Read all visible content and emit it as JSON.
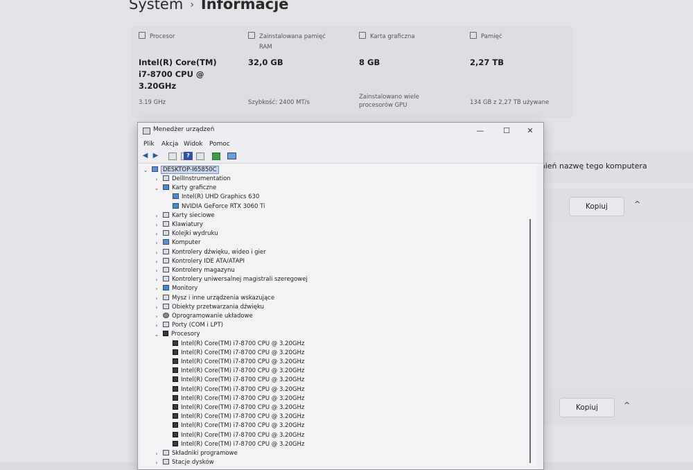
{
  "breadcrumb": {
    "parent": "System",
    "separator": "›",
    "current": "Informacje"
  },
  "specs": [
    {
      "icon": "cpu-icon",
      "label": "Procesor",
      "value_lines": [
        "Intel(R) Core(TM)",
        "i7-8700 CPU @",
        "3.20GHz"
      ],
      "sub_lines": [
        "3.19 GHz"
      ]
    },
    {
      "icon": "ram-icon",
      "label_lines": [
        "Zainstalowana pamięć",
        "RAM"
      ],
      "value_lines": [
        "32,0 GB"
      ],
      "sub_lines": [
        "Szybkość: 2400 MT/s"
      ]
    },
    {
      "icon": "gpu-icon",
      "label": "Karta graficzna",
      "value_lines": [
        "8 GB"
      ],
      "sub_lines": [
        "Zainstalowano wiele",
        "procesorów GPU"
      ]
    },
    {
      "icon": "storage-icon",
      "label": "Pamięć",
      "value_lines": [
        "2,27 TB"
      ],
      "sub_lines": [
        "134 GB z 2,27 TB używane"
      ]
    }
  ],
  "rename": {
    "label": "mień nazwę tego komputera"
  },
  "cards": [
    {
      "copy_label": "Kopiuj",
      "chevron": "^"
    },
    {
      "copy_label": "Kopiuj",
      "chevron": "^"
    }
  ],
  "device_manager": {
    "title": "Menedżer urządzeń",
    "controls": {
      "minimize": "—",
      "maximize": "☐",
      "close": "✕"
    },
    "menu": [
      "Plik",
      "Akcja",
      "Widok",
      "Pomoc"
    ],
    "toolbar": [
      "back-arrow-icon",
      "forward-arrow-icon",
      "properties-icon",
      "properties-icon",
      "help-icon",
      "properties-icon",
      "scan-icon",
      "monitor-icon"
    ],
    "root": "DESKTOP-I65850C",
    "tree": [
      {
        "label": "DellInstrumentation",
        "level": 1,
        "expander": "›",
        "icon": "device-icon"
      },
      {
        "label": "Karty graficzne",
        "level": 1,
        "expander": "⌄",
        "icon": "monitor-icon"
      },
      {
        "label": "Intel(R) UHD Graphics 630",
        "level": 2,
        "expander": "",
        "icon": "monitor-icon"
      },
      {
        "label": "NVIDIA GeForce RTX 3060 Ti",
        "level": 2,
        "expander": "",
        "icon": "monitor-icon"
      },
      {
        "label": "Karty sieciowe",
        "level": 1,
        "expander": "›",
        "icon": "network-icon"
      },
      {
        "label": "Klawiatury",
        "level": 1,
        "expander": "›",
        "icon": "keyboard-icon"
      },
      {
        "label": "Kolejki wydruku",
        "level": 1,
        "expander": "›",
        "icon": "printer-icon"
      },
      {
        "label": "Komputer",
        "level": 1,
        "expander": "›",
        "icon": "computer-icon"
      },
      {
        "label": "Kontrolery dźwięku, wideo i gier",
        "level": 1,
        "expander": "›",
        "icon": "speaker-icon"
      },
      {
        "label": "Kontrolery IDE ATA/ATAPI",
        "level": 1,
        "expander": "›",
        "icon": "controller-icon"
      },
      {
        "label": "Kontrolery magazynu",
        "level": 1,
        "expander": "›",
        "icon": "storage-icon"
      },
      {
        "label": "Kontrolery uniwersalnej magistrali szeregowej",
        "level": 1,
        "expander": "›",
        "icon": "usb-icon"
      },
      {
        "label": "Monitory",
        "level": 1,
        "expander": "›",
        "icon": "monitor-icon"
      },
      {
        "label": "Mysz i inne urządzenia wskazujące",
        "level": 1,
        "expander": "›",
        "icon": "mouse-icon"
      },
      {
        "label": "Obiekty przetwarzania dźwięku",
        "level": 1,
        "expander": "›",
        "icon": "speaker-icon"
      },
      {
        "label": "Oprogramowanie układowe",
        "level": 1,
        "expander": "›",
        "icon": "firmware-icon"
      },
      {
        "label": "Porty (COM i LPT)",
        "level": 1,
        "expander": "›",
        "icon": "port-icon"
      },
      {
        "label": "Procesory",
        "level": 1,
        "expander": "⌄",
        "icon": "cpu-icon"
      },
      {
        "label": "Intel(R) Core(TM) i7-8700 CPU @ 3.20GHz",
        "level": 2,
        "expander": "",
        "icon": "cpu-icon"
      },
      {
        "label": "Intel(R) Core(TM) i7-8700 CPU @ 3.20GHz",
        "level": 2,
        "expander": "",
        "icon": "cpu-icon"
      },
      {
        "label": "Intel(R) Core(TM) i7-8700 CPU @ 3.20GHz",
        "level": 2,
        "expander": "",
        "icon": "cpu-icon"
      },
      {
        "label": "Intel(R) Core(TM) i7-8700 CPU @ 3.20GHz",
        "level": 2,
        "expander": "",
        "icon": "cpu-icon"
      },
      {
        "label": "Intel(R) Core(TM) i7-8700 CPU @ 3.20GHz",
        "level": 2,
        "expander": "",
        "icon": "cpu-icon"
      },
      {
        "label": "Intel(R) Core(TM) i7-8700 CPU @ 3.20GHz",
        "level": 2,
        "expander": "",
        "icon": "cpu-icon"
      },
      {
        "label": "Intel(R) Core(TM) i7-8700 CPU @ 3.20GHz",
        "level": 2,
        "expander": "",
        "icon": "cpu-icon"
      },
      {
        "label": "Intel(R) Core(TM) i7-8700 CPU @ 3.20GHz",
        "level": 2,
        "expander": "",
        "icon": "cpu-icon"
      },
      {
        "label": "Intel(R) Core(TM) i7-8700 CPU @ 3.20GHz",
        "level": 2,
        "expander": "",
        "icon": "cpu-icon"
      },
      {
        "label": "Intel(R) Core(TM) i7-8700 CPU @ 3.20GHz",
        "level": 2,
        "expander": "",
        "icon": "cpu-icon"
      },
      {
        "label": "Intel(R) Core(TM) i7-8700 CPU @ 3.20GHz",
        "level": 2,
        "expander": "",
        "icon": "cpu-icon"
      },
      {
        "label": "Intel(R) Core(TM) i7-8700 CPU @ 3.20GHz",
        "level": 2,
        "expander": "",
        "icon": "cpu-icon"
      },
      {
        "label": "Składniki programowe",
        "level": 1,
        "expander": "›",
        "icon": "software-component-icon"
      },
      {
        "label": "Stacje dysków",
        "level": 1,
        "expander": "›",
        "icon": "disk-icon"
      }
    ]
  }
}
